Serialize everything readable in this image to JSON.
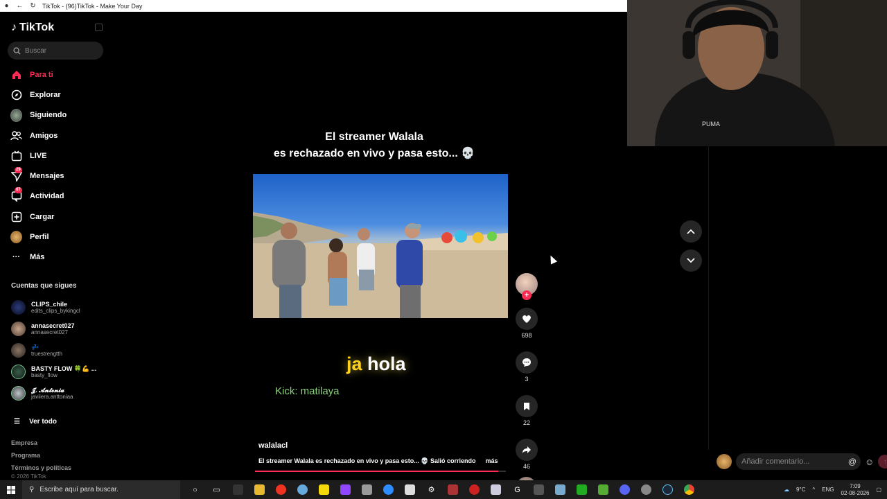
{
  "browser": {
    "title": "TikTok - (96)TikTok - Make Your Day"
  },
  "sidebar": {
    "logo": "TikTok",
    "search_placeholder": "Buscar",
    "nav": [
      {
        "label": "Para ti",
        "icon": "home-icon",
        "active": true
      },
      {
        "label": "Explorar",
        "icon": "compass-icon"
      },
      {
        "label": "Siguiendo",
        "icon": "following-avatar-icon"
      },
      {
        "label": "Amigos",
        "icon": "friends-icon"
      },
      {
        "label": "LIVE",
        "icon": "live-icon"
      },
      {
        "label": "Mensajes",
        "icon": "messages-icon",
        "badge": "29"
      },
      {
        "label": "Actividad",
        "icon": "activity-icon",
        "badge": "67"
      },
      {
        "label": "Cargar",
        "icon": "upload-icon"
      },
      {
        "label": "Perfil",
        "icon": "profile-avatar-icon"
      },
      {
        "label": "Más",
        "icon": "more-icon"
      }
    ],
    "following_title": "Cuentas que sigues",
    "following": [
      {
        "name": "CLIPS_chile",
        "handle": "edits_clips_bykingcl"
      },
      {
        "name": "annasecret027",
        "handle": "annasecret027"
      },
      {
        "name": "💤",
        "handle": "truestrengtth"
      },
      {
        "name": "BASTY FLOW 🍀💪 ...",
        "handle": "basty_flow"
      },
      {
        "name": "𝓙. 𝓐𝓷𝓽𝓸𝓷𝓲𝓪",
        "handle": "javiiera.anttoniaa"
      }
    ],
    "see_all": "Ver todo",
    "footer": [
      "Empresa",
      "Programa",
      "Términos y políticas"
    ],
    "copyright": "© 2026 TikTok"
  },
  "video": {
    "overlay_title_line1": "El streamer Walala",
    "overlay_title_line2": "es rechazado en vivo y pasa esto... 💀",
    "caption_word1": "ja",
    "caption_word2": "hola",
    "kick": "Kick: matilaya",
    "author": "walalacl",
    "description": "El streamer Walala es rechazado en vivo y pasa esto... 💀 Salió corriendo",
    "more": "más",
    "progress": 0.97
  },
  "actions": {
    "likes": "698",
    "comments": "3",
    "saves": "22",
    "shares": "46"
  },
  "comment_input": {
    "placeholder": "Añadir comentario..."
  },
  "taskbar": {
    "search_placeholder": "Escribe aquí para buscar.",
    "weather": "9°C",
    "lang": "ENG",
    "time": "7:09",
    "date": "02-08-2026"
  },
  "colors": {
    "accent": "#fe2c55",
    "caption_yellow": "#ffd21e",
    "kick_green": "#8bd17c"
  }
}
